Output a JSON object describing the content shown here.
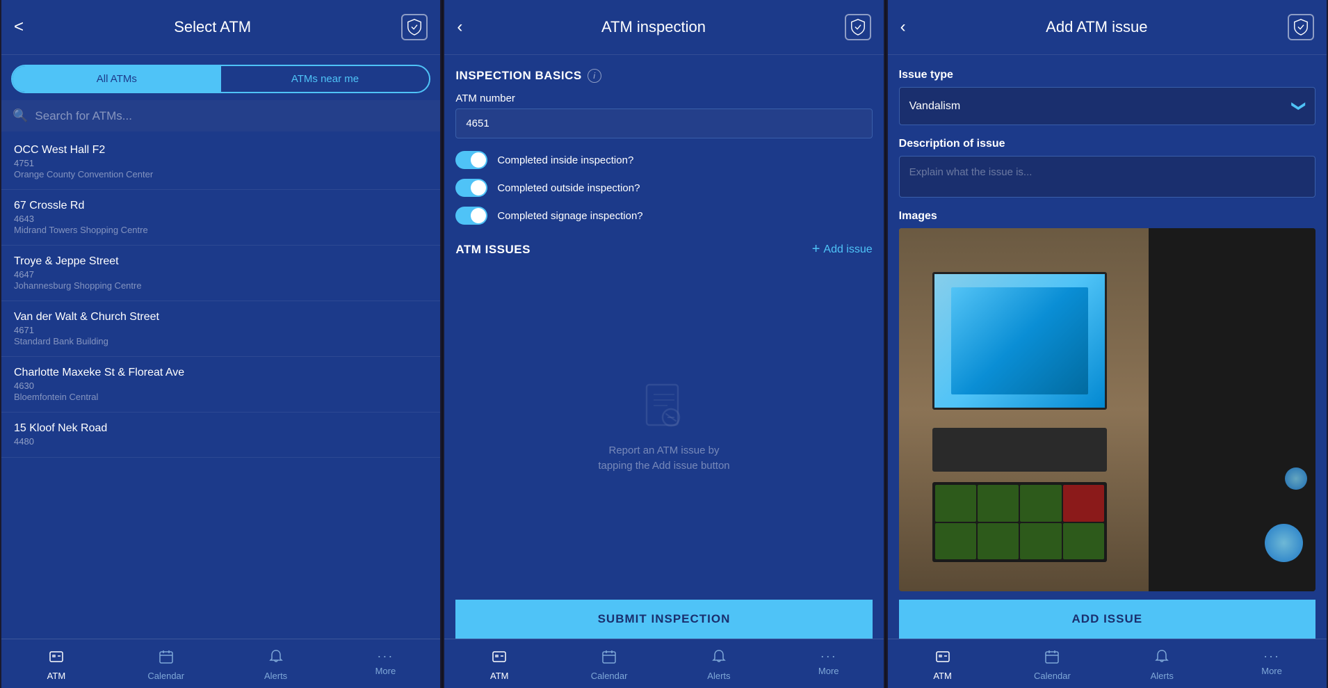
{
  "screen1": {
    "title": "Select ATM",
    "back_label": "<",
    "tabs": [
      {
        "id": "all",
        "label": "All ATMs",
        "active": true
      },
      {
        "id": "near",
        "label": "ATMs near me",
        "active": false
      }
    ],
    "search_placeholder": "Search for ATMs...",
    "atm_list": [
      {
        "name": "OCC West Hall F2",
        "code": "4751",
        "location": "Orange County Convention Center"
      },
      {
        "name": "67 Crossle Rd",
        "code": "4643",
        "location": "Midrand Towers Shopping Centre"
      },
      {
        "name": "Troye & Jeppe Street",
        "code": "4647",
        "location": "Johannesburg Shopping Centre"
      },
      {
        "name": "Van der Walt & Church Street",
        "code": "4671",
        "location": "Standard Bank Building"
      },
      {
        "name": "Charlotte Maxeke St & Floreat Ave",
        "code": "4630",
        "location": "Bloemfontein Central"
      },
      {
        "name": "15 Kloof Nek Road",
        "code": "4480",
        "location": ""
      }
    ],
    "nav": {
      "items": [
        {
          "label": "ATM",
          "icon": "📋",
          "active": true
        },
        {
          "label": "Calendar",
          "icon": "📅",
          "active": false
        },
        {
          "label": "Alerts",
          "icon": "🔔",
          "active": false
        },
        {
          "label": "More",
          "icon": "···",
          "active": false
        }
      ]
    }
  },
  "screen2": {
    "title": "ATM inspection",
    "back_label": "<",
    "section_basics": "INSPECTION BASICS",
    "atm_number_label": "ATM number",
    "atm_number_value": "4651",
    "toggles": [
      {
        "label": "Completed inside inspection?",
        "on": true
      },
      {
        "label": "Completed outside inspection?",
        "on": true
      },
      {
        "label": "Completed signage inspection?",
        "on": true
      }
    ],
    "section_issues": "ATM ISSUES",
    "add_issue_label": "Add issue",
    "empty_text": "Report an ATM issue by\ntapping the Add issue button",
    "submit_label": "SUBMIT INSPECTION",
    "nav": {
      "items": [
        {
          "label": "ATM",
          "icon": "📋",
          "active": true
        },
        {
          "label": "Calendar",
          "icon": "📅",
          "active": false
        },
        {
          "label": "Alerts",
          "icon": "🔔",
          "active": false
        },
        {
          "label": "More",
          "icon": "···",
          "active": false
        }
      ]
    }
  },
  "screen3": {
    "title": "Add ATM issue",
    "back_label": "<",
    "issue_type_label": "Issue type",
    "issue_type_value": "Vandalism",
    "description_label": "Description of issue",
    "description_placeholder": "Explain what the issue is...",
    "images_label": "Images",
    "add_issue_btn_label": "ADD ISSUE",
    "nav": {
      "items": [
        {
          "label": "ATM",
          "icon": "📋",
          "active": true
        },
        {
          "label": "Calendar",
          "icon": "📅",
          "active": false
        },
        {
          "label": "Alerts",
          "icon": "🔔",
          "active": false
        },
        {
          "label": "More",
          "icon": "···",
          "active": false
        }
      ]
    }
  },
  "icons": {
    "shield": "shield",
    "back": "‹",
    "info": "i",
    "search": "🔍",
    "plus": "+",
    "chevron_down": "❯",
    "atm_nav": "⊞",
    "calendar_nav": "📅",
    "alerts_nav": "🔔",
    "more_nav": "···"
  }
}
